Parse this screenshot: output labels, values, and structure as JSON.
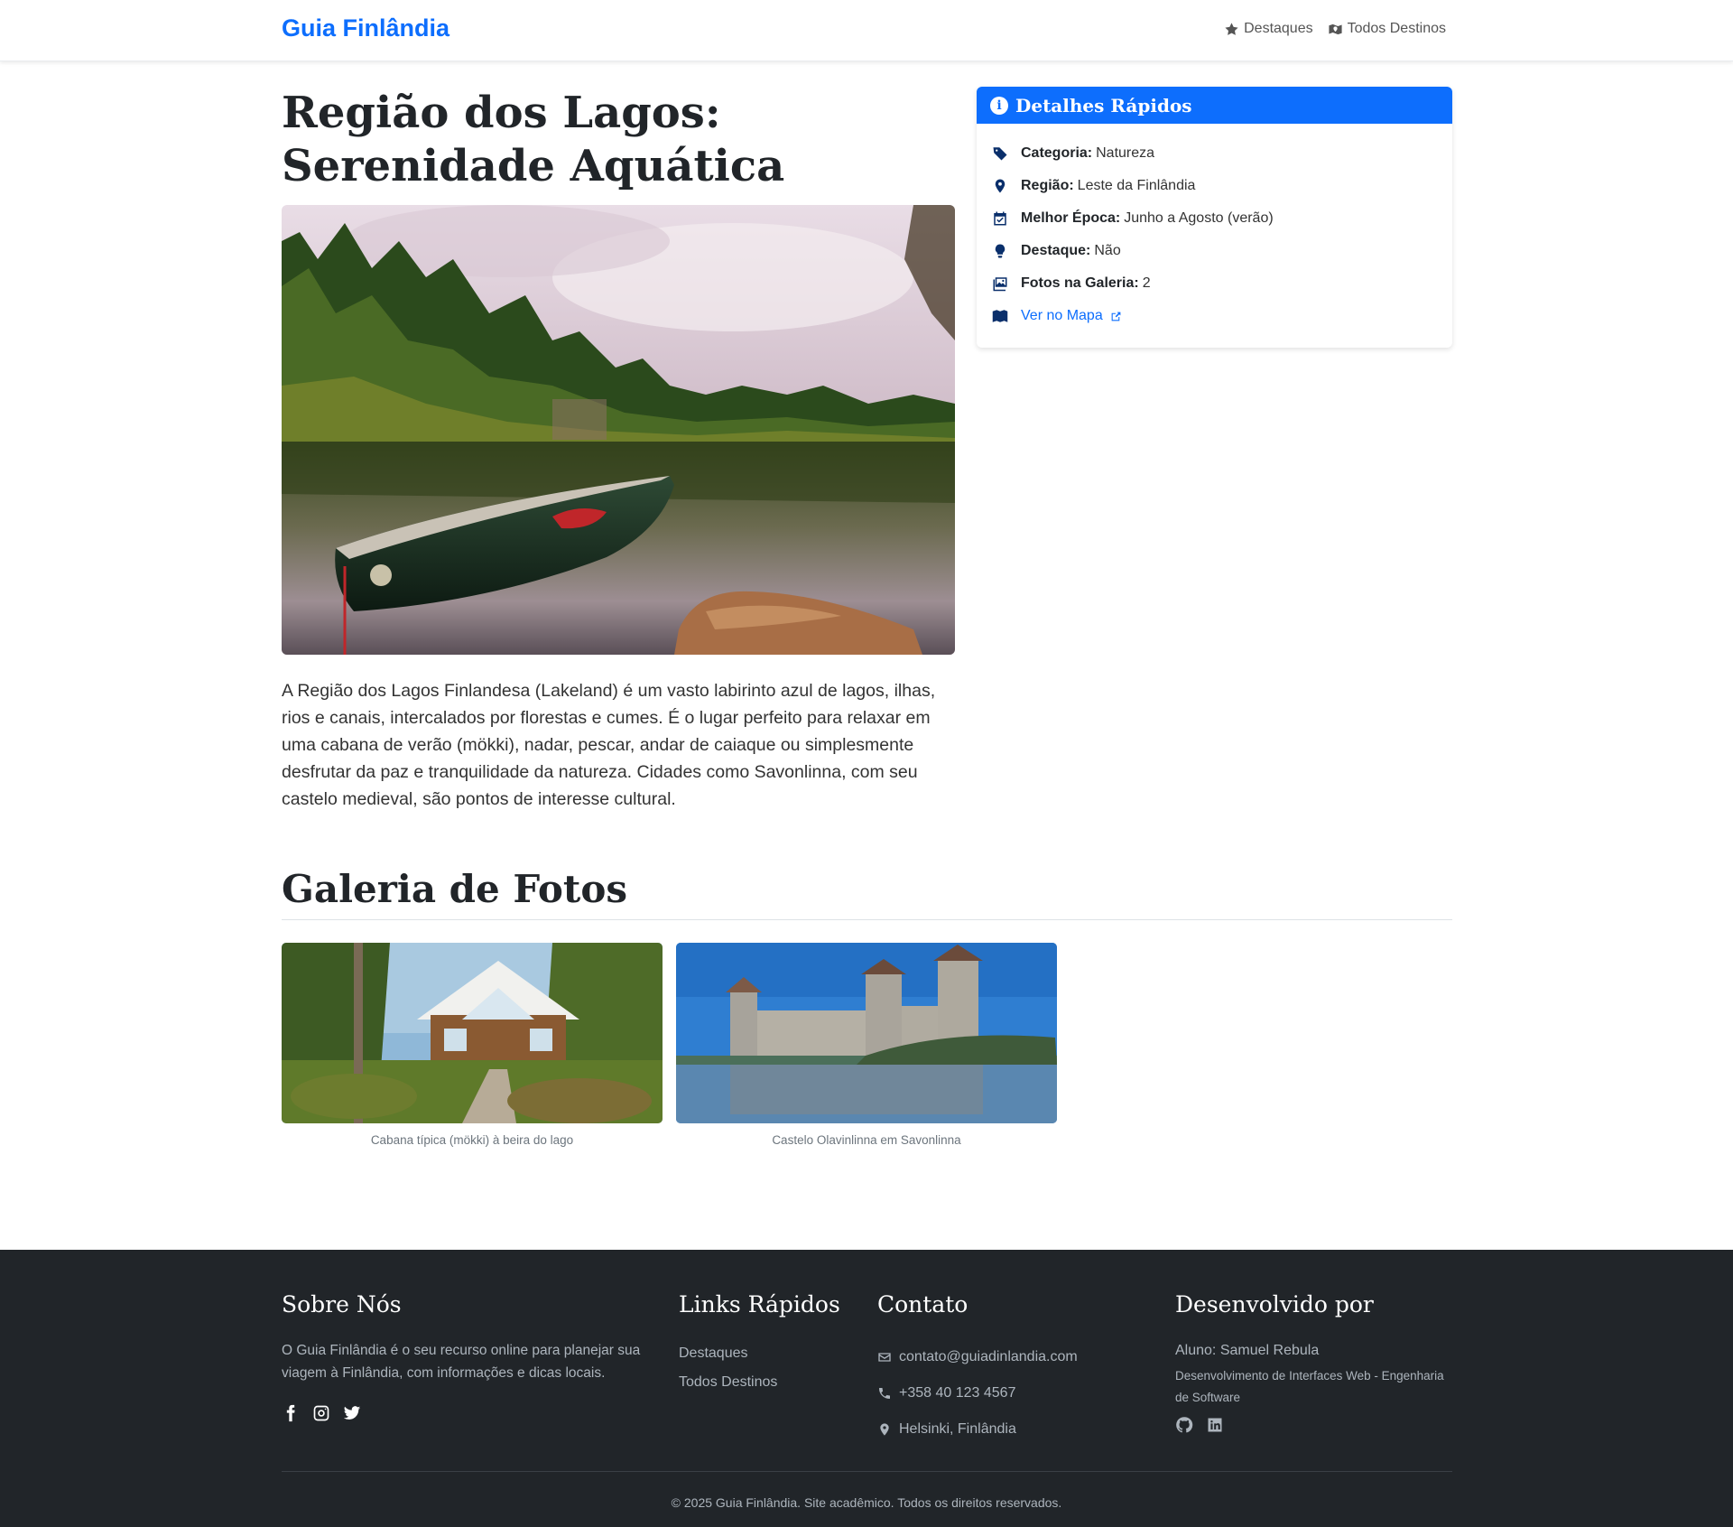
{
  "nav": {
    "brand": "Guia Finlândia",
    "links": [
      {
        "label": "Destaques",
        "icon": "star-icon"
      },
      {
        "label": "Todos Destinos",
        "icon": "map-location-icon"
      }
    ]
  },
  "main": {
    "title": "Região dos Lagos: Serenidade Aquática",
    "hero_alt": "Canoa no lago",
    "description": "A Região dos Lagos Finlandesa (Lakeland) é um vasto labirinto azul de lagos, ilhas, rios e canais, intercalados por florestas e cumes. É o lugar perfeito para relaxar em uma cabana de verão (mökki), nadar, pescar, andar de caiaque ou simplesmente desfrutar da paz e tranquilidade da natureza. Cidades como Savonlinna, com seu castelo medieval, são pontos de interesse cultural."
  },
  "details": {
    "header": "Detalhes Rápidos",
    "rows": [
      {
        "label": "Categoria:",
        "value": "Natureza",
        "icon": "tag-icon"
      },
      {
        "label": "Região:",
        "value": "Leste da Finlândia",
        "icon": "location-pin-icon"
      },
      {
        "label": "Melhor Época:",
        "value": "Junho a Agosto (verão)",
        "icon": "calendar-check-icon"
      },
      {
        "label": "Destaque:",
        "value": "Não",
        "icon": "lightbulb-icon"
      },
      {
        "label": "Fotos na Galeria:",
        "value": "2",
        "icon": "images-icon"
      }
    ],
    "map_link": "Ver no Mapa"
  },
  "gallery": {
    "title": "Galeria de Fotos",
    "items": [
      {
        "caption": "Cabana típica (mökki) à beira do lago"
      },
      {
        "caption": "Castelo Olavinlinna em Savonlinna"
      }
    ]
  },
  "footer": {
    "about": {
      "title": "Sobre Nós",
      "text": "O Guia Finlândia é o seu recurso online para planejar sua viagem à Finlândia, com informações e dicas locais."
    },
    "links": {
      "title": "Links Rápidos",
      "items": [
        "Destaques",
        "Todos Destinos"
      ]
    },
    "contact": {
      "title": "Contato",
      "email": "contato@guiadinlandia.com",
      "phone": "+358 40 123 4567",
      "location": "Helsinki, Finlândia"
    },
    "dev": {
      "title": "Desenvolvido por",
      "student": "Aluno: Samuel Rebula",
      "course": "Desenvolvimento de Interfaces Web - Engenharia de Software"
    },
    "copyright": "© 2025 Guia Finlândia. Site acadêmico. Todos os direitos reservados."
  },
  "colors": {
    "brand": "#0d6efd",
    "footer_bg": "#212529",
    "icon_dark": "#0a2f6b"
  }
}
